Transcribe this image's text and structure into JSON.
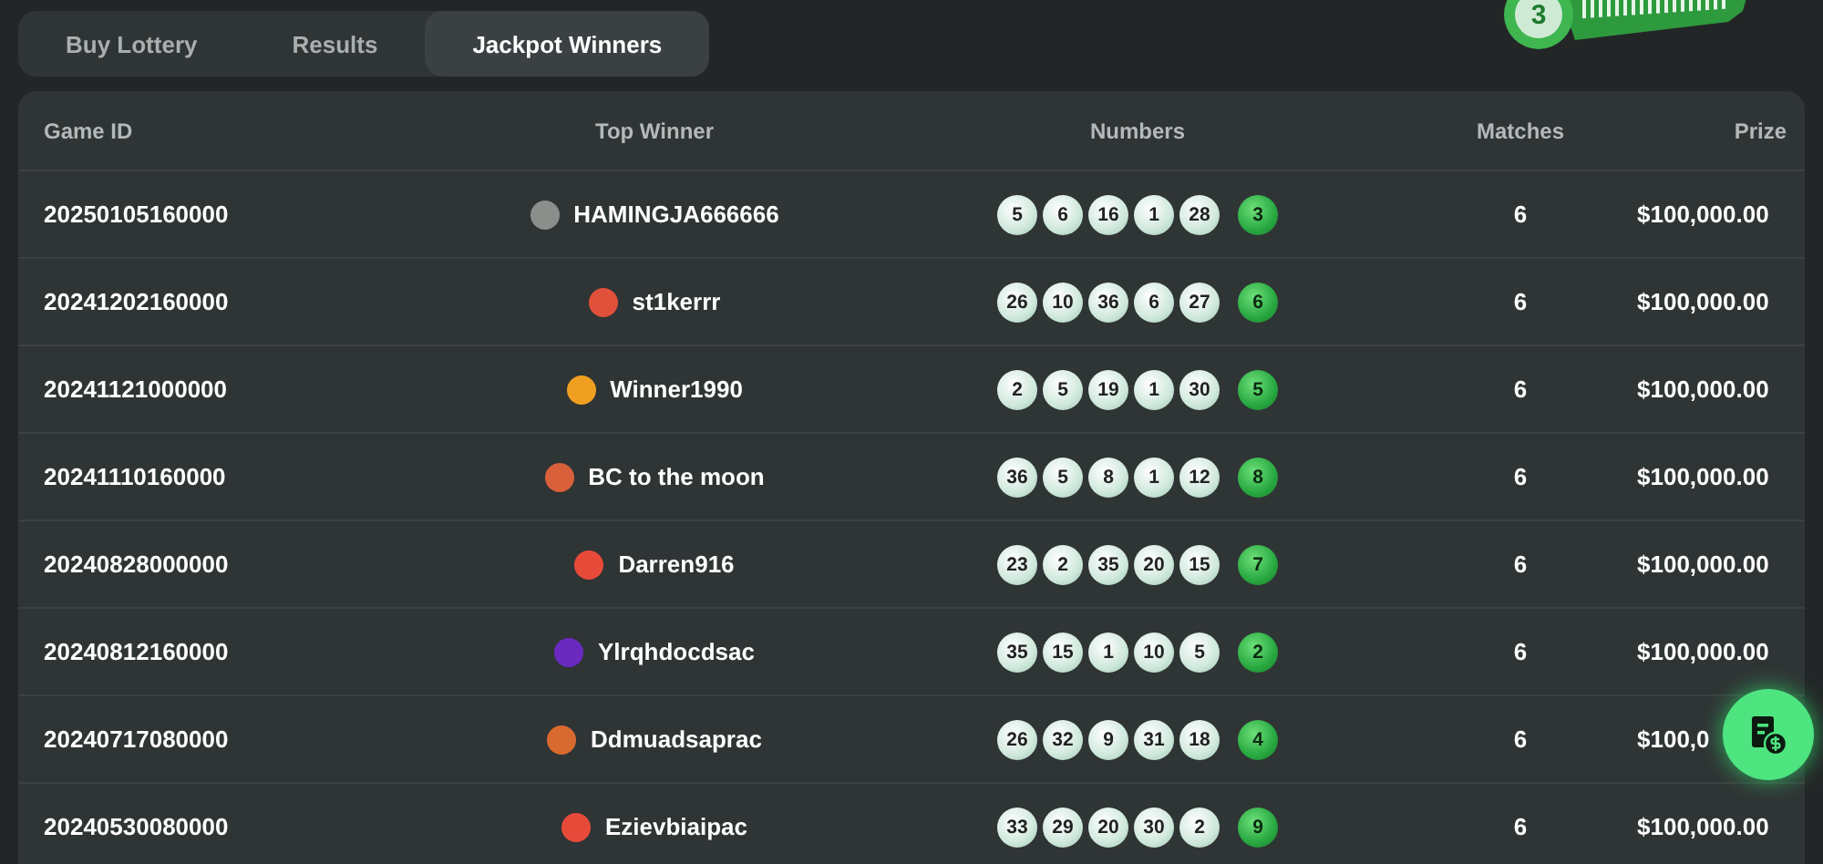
{
  "tabs": [
    {
      "label": "Buy Lottery",
      "selected": false
    },
    {
      "label": "Results",
      "selected": false
    },
    {
      "label": "Jackpot Winners",
      "selected": true
    }
  ],
  "promo_ball": "3",
  "table": {
    "columns": [
      "Game ID",
      "Top Winner",
      "Numbers",
      "Matches",
      "Prize"
    ],
    "rows": [
      {
        "game_id": "20250105160000",
        "winner": "HAMINGJA666666",
        "color": "#8a8f8c",
        "numbers": [
          "5",
          "6",
          "16",
          "1",
          "28"
        ],
        "bonus": "3",
        "matches": "6",
        "prize": "$100,000.00"
      },
      {
        "game_id": "20241202160000",
        "winner": "st1kerrr",
        "color": "#e0503a",
        "numbers": [
          "26",
          "10",
          "36",
          "6",
          "27"
        ],
        "bonus": "6",
        "matches": "6",
        "prize": "$100,000.00"
      },
      {
        "game_id": "20241121000000",
        "winner": "Winner1990",
        "color": "#f0a020",
        "numbers": [
          "2",
          "5",
          "19",
          "1",
          "30"
        ],
        "bonus": "5",
        "matches": "6",
        "prize": "$100,000.00"
      },
      {
        "game_id": "20241110160000",
        "winner": "BC to the moon",
        "color": "#d8603a",
        "numbers": [
          "36",
          "5",
          "8",
          "1",
          "12"
        ],
        "bonus": "8",
        "matches": "6",
        "prize": "$100,000.00"
      },
      {
        "game_id": "20240828000000",
        "winner": "Darren916",
        "color": "#e84a3a",
        "numbers": [
          "23",
          "2",
          "35",
          "20",
          "15"
        ],
        "bonus": "7",
        "matches": "6",
        "prize": "$100,000.00"
      },
      {
        "game_id": "20240812160000",
        "winner": "Ylrqhdocdsac",
        "color": "#6a2ac0",
        "numbers": [
          "35",
          "15",
          "1",
          "10",
          "5"
        ],
        "bonus": "2",
        "matches": "6",
        "prize": "$100,000.00"
      },
      {
        "game_id": "20240717080000",
        "winner": "Ddmuadsaprac",
        "color": "#d86a30",
        "numbers": [
          "26",
          "32",
          "9",
          "31",
          "18"
        ],
        "bonus": "4",
        "matches": "6",
        "prize": "$100,0"
      },
      {
        "game_id": "20240530080000",
        "winner": "Ezievbiaipac",
        "color": "#e84a3a",
        "numbers": [
          "33",
          "29",
          "20",
          "30",
          "2"
        ],
        "bonus": "9",
        "matches": "6",
        "prize": "$100,000.00"
      }
    ]
  }
}
